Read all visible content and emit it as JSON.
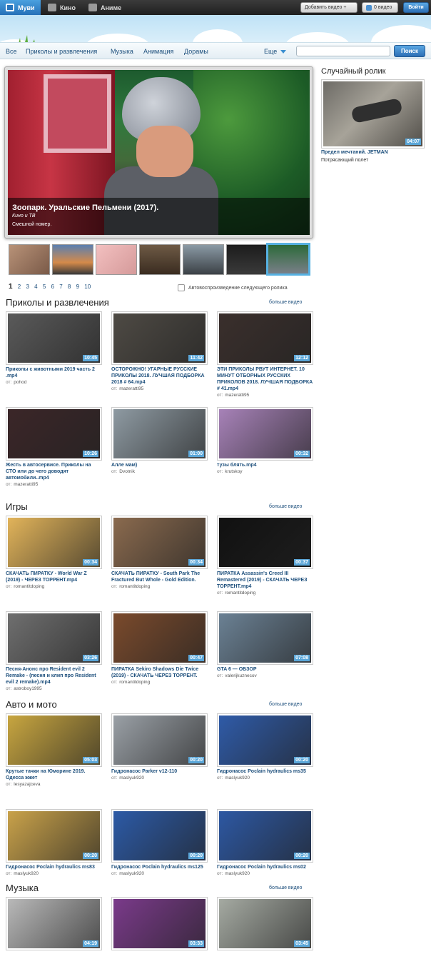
{
  "topbar": {
    "brand_movie": "Муви",
    "brand_kino": "Кино",
    "brand_anime": "Аниме",
    "add_video": "Добавить видео +",
    "video_count": "0 видео",
    "login": "Войти"
  },
  "nav": {
    "items": [
      "Все",
      "Приколы и развлечения",
      "Музыка",
      "Анимация",
      "Дорамы"
    ],
    "more": "Еще",
    "search_placeholder": "",
    "search_button": "Поиск"
  },
  "featured": {
    "title": "Зоопарк. Уральские Пельмени (2017).",
    "category": "Кино и ТВ",
    "description": "Смешной номер."
  },
  "pager": {
    "current": "1",
    "pages": [
      "2",
      "3",
      "4",
      "5",
      "6",
      "7",
      "8",
      "9",
      "10"
    ]
  },
  "autoplay_label": "Автовоспроизведение следующего ролика",
  "random": {
    "heading": "Случайный ролик",
    "duration": "04:07",
    "title": "Предел мечтаний. JETMAN",
    "description": "Потрясающий полет"
  },
  "author_label": "от:",
  "more_label": "больше видео",
  "sections": [
    {
      "title": "Приколы и развлечения",
      "videos": [
        {
          "title": "Приколы с животными 2019 часть 2 .mp4",
          "author": "pohod",
          "duration": "10:45",
          "color": "#5a5a5a"
        },
        {
          "title": "ОСТОРОЖНО! УГАРНЫЕ РУССКИЕ ПРИКОЛЫ 2018. ЛУЧШАЯ ПОДБОРКА 2018 # 64.mp4",
          "author": "mazeratti95",
          "duration": "11:42",
          "color": "#4e4a44"
        },
        {
          "title": "ЭТИ ПРИКОЛЫ РВУТ ИНТЕРНЕТ. 10 МИНУТ ОТБОРНЫХ РУССКИХ ПРИКОЛОВ 2018. ЛУЧШАЯ ПОДБОРКА # 41.mp4",
          "author": "mazeratti95",
          "duration": "12:12",
          "color": "#3a2f2c"
        },
        {
          "title": "Жесть в автосервисе. Приколы на СТО или до чего доводят автомобили..mp4",
          "author": "mazeratti95",
          "duration": "10:26",
          "color": "#3b2628"
        },
        {
          "title": "Алле мам)",
          "author": "Dvotnik",
          "duration": "01:00",
          "color": "#8e9aa2"
        },
        {
          "title": "тузы блять.mp4",
          "author": "krutskoy",
          "duration": "00:32",
          "color": "#a782b8"
        }
      ]
    },
    {
      "title": "Игры",
      "videos": [
        {
          "title": "СКАЧАТЬ ПИРАТКУ - World War Z (2019) - ЧЕРЕЗ ТОРРЕНТ.mp4",
          "author": "romantitdoping",
          "duration": "00:34",
          "color": "#e2b45a"
        },
        {
          "title": "СКАЧАТЬ ПИРАТКУ - South Park The Fractured But Whole - Gold Edition.",
          "author": "romantitdoping",
          "duration": "00:34",
          "color": "#8a6a4e"
        },
        {
          "title": "ПИРАТКА Assassin's Creed III Remastered (2019) - СКАЧАТЬ ЧЕРЕЗ ТОРРЕНТ.mp4",
          "author": "romantitdoping",
          "duration": "00:37",
          "color": "#111111"
        },
        {
          "title": "Песня-Анонс про Resident evil 2 Remake - (песня и клип про Resident evil 2 remake).mp4",
          "author": "astroboy1995",
          "duration": "03:26",
          "color": "#6f6f6f"
        },
        {
          "title": "ПИРАТКА Sekiro Shadows Die Twice (2019) - СКАЧАТЬ ЧЕРЕЗ ТОРРЕНТ.",
          "author": "romantitdoping",
          "duration": "00:47",
          "color": "#7a4a2c"
        },
        {
          "title": "GTA 6 — ОБЗОР",
          "author": "valerijkuznecov",
          "duration": "07:08",
          "color": "#6b8194"
        }
      ]
    },
    {
      "title": "Авто и мото",
      "videos": [
        {
          "title": "Крутые тачки на Юморине 2019. Одесса жжет",
          "author": "lesyazajceva",
          "duration": "05:03",
          "color": "#c8a640"
        },
        {
          "title": "Гидронасос Parker v12-110",
          "author": "maslyuk920",
          "duration": "00:20",
          "color": "#9aa0a6"
        },
        {
          "title": "Гидронасос Poclain hydraulics ms35",
          "author": "maslyuk920",
          "duration": "00:20",
          "color": "#2f5ba8"
        },
        {
          "title": "Гидронасос Poclain hydraulics ms83",
          "author": "maslyuk920",
          "duration": "00:20",
          "color": "#c9a24a"
        },
        {
          "title": "Гидронасос Poclain hydraulics ms125",
          "author": "maslyuk920",
          "duration": "00:20",
          "color": "#2c5aa6"
        },
        {
          "title": "Гидронасос Poclain hydraulics ms02",
          "author": "maslyuk920",
          "duration": "00:20",
          "color": "#2d58a3"
        }
      ]
    },
    {
      "title": "Музыка",
      "videos": [
        {
          "title": "",
          "author": "",
          "duration": "04:19",
          "color": "#b9b9b9"
        },
        {
          "title": "",
          "author": "",
          "duration": "03:33",
          "color": "#7a3a8a"
        },
        {
          "title": "",
          "author": "",
          "duration": "03:45",
          "color": "#a5aaa2"
        }
      ]
    }
  ]
}
